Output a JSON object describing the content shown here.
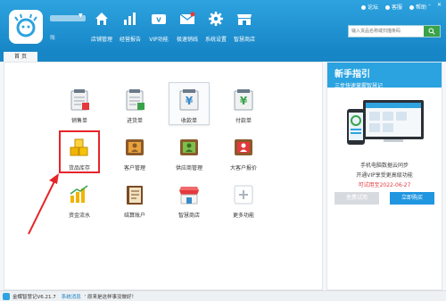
{
  "header": {
    "user_sub": "账",
    "nav": [
      {
        "label": "店铺管理",
        "icon": "home-icon"
      },
      {
        "label": "经营报告",
        "icon": "bar-chart-icon"
      },
      {
        "label": "VIP功能",
        "icon": "vip-icon"
      },
      {
        "label": "极速销线",
        "icon": "mail-icon"
      },
      {
        "label": "系统设置",
        "icon": "gear-icon"
      },
      {
        "label": "智慧商店",
        "icon": "store-icon"
      }
    ],
    "links": {
      "forum": "论坛",
      "service": "客服",
      "help": "帮助"
    },
    "search_placeholder": "输入货品名称或扫描条码"
  },
  "tabs": {
    "home": "首 页"
  },
  "tiles": [
    {
      "label": "销售单",
      "icon": "sales-order-icon"
    },
    {
      "label": "进货单",
      "icon": "purchase-order-icon"
    },
    {
      "label": "收款单",
      "icon": "receipt-icon"
    },
    {
      "label": "付款单",
      "icon": "payment-icon"
    },
    {
      "label": "货品库存",
      "icon": "inventory-icon"
    },
    {
      "label": "客户管理",
      "icon": "customer-icon"
    },
    {
      "label": "供应商管理",
      "icon": "supplier-icon"
    },
    {
      "label": "大客户报价",
      "icon": "quote-icon"
    },
    {
      "label": "资金流水",
      "icon": "cash-flow-icon"
    },
    {
      "label": "结算账户",
      "icon": "account-icon"
    },
    {
      "label": "智慧商店",
      "icon": "smart-store-icon"
    },
    {
      "label": "更多功能",
      "icon": "plus-icon"
    }
  ],
  "promo": {
    "title": "新手指引",
    "subtitle": "三步快速掌握智慧记",
    "line1": "手机电脑数据云同步",
    "line2": "开通VIP享受更高级功能",
    "expire": "可试用至2022-06-27",
    "trial_button": "免费试用",
    "buy_button": "立即购买"
  },
  "status": {
    "version": "金蝶智慧记V6.21.7",
    "msg_label": "系统消息",
    "message": "' 原来是这样事没做好！"
  },
  "colors": {
    "brand": "#1786c7",
    "highlight": "#e6252a",
    "buy": "#2196e0"
  }
}
